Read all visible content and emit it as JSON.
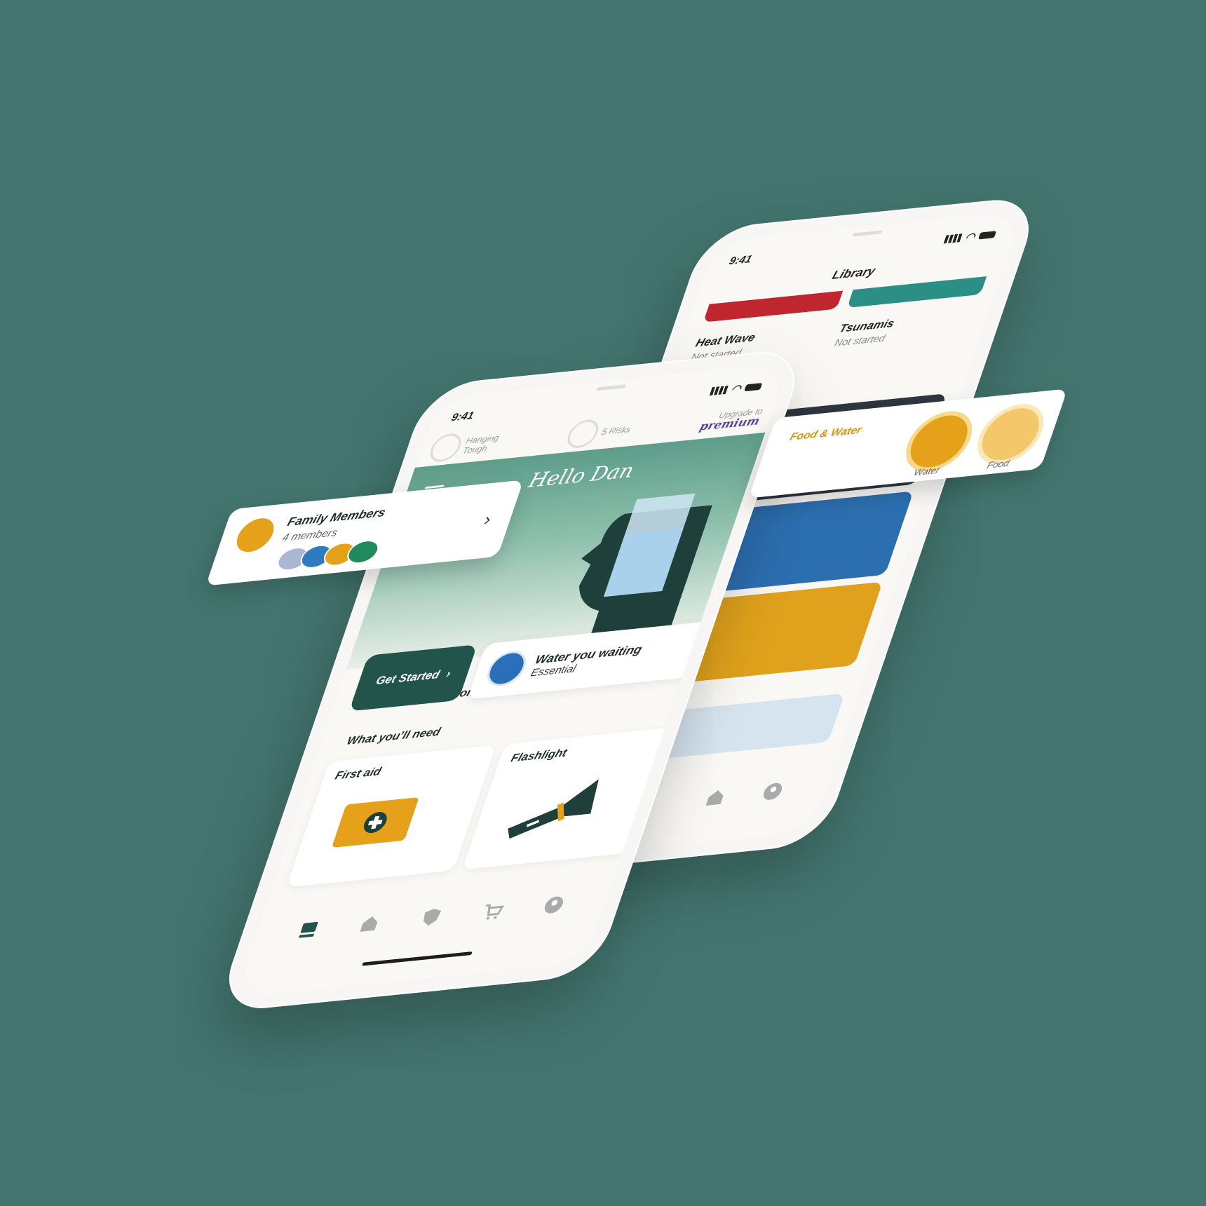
{
  "colors": {
    "background": "#43756e",
    "accent_green": "#23544c",
    "accent_yellow": "#e6a11b",
    "premium_purple": "#5a3ea8",
    "water_blue": "#2a6fb7"
  },
  "back_phone": {
    "time": "9:41",
    "title": "Library",
    "items": [
      {
        "name": "Heat Wave",
        "status": "Not started",
        "color": "#c0262d"
      },
      {
        "name": "Tsunamis",
        "status": "Not started",
        "color": "#2b8f86"
      }
    ],
    "nav_icons": [
      "home-icon",
      "profile-icon"
    ]
  },
  "front_phone": {
    "time": "9:41",
    "top_strip": {
      "level_label_line1": "Hanging",
      "level_label_line2": "Tough",
      "risks_label": "5 Risks",
      "upgrade_label": "Upgrade to",
      "premium_label": "premium"
    },
    "greeting": "Hello Dan",
    "focus_heading": "What you’ll focus on",
    "get_started_label": "Get Started",
    "focus_card": {
      "title": "Water you waiting",
      "subtitle": "Essential"
    },
    "need_heading": "What you’ll need",
    "need_items": [
      {
        "name": "First aid",
        "icon": "first-aid-kit-icon"
      },
      {
        "name": "Flashlight",
        "icon": "flashlight-icon"
      }
    ],
    "nav_icons": [
      "dashboard-icon",
      "home-icon",
      "shield-icon",
      "cart-icon",
      "profile-icon"
    ]
  },
  "family_card": {
    "title": "Family Members",
    "subtitle": "4 members",
    "avatar_colors": [
      "#a9b6d6",
      "#2f7bc0",
      "#e6a11b",
      "#1f8a5c"
    ]
  },
  "food_water_card": {
    "title": "Food & Water",
    "items": [
      {
        "label": "Water",
        "icon": "water-drop-icon"
      },
      {
        "label": "Food",
        "icon": "fork-knife-icon"
      }
    ]
  }
}
